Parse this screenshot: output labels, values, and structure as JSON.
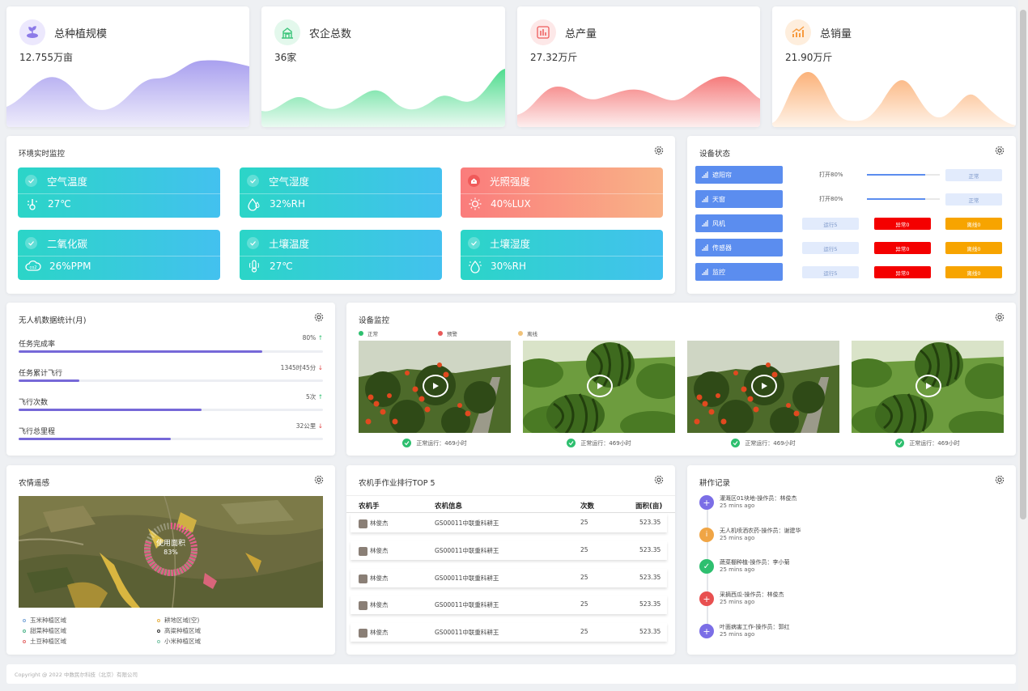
{
  "stats": [
    {
      "title": "总种植规模",
      "value": "12.755万亩",
      "icon": "plant-icon",
      "color": "#a9a0ef"
    },
    {
      "title": "农企总数",
      "value": "36家",
      "icon": "building-icon",
      "color": "#4fdc8e"
    },
    {
      "title": "总产量",
      "value": "27.32万斤",
      "icon": "bar-chart-icon",
      "color": "#f57b7b"
    },
    {
      "title": "总销量",
      "value": "21.90万斤",
      "icon": "trend-chart-icon",
      "color": "#fbb27a"
    }
  ],
  "env": {
    "title": "环境实时监控",
    "tiles": [
      {
        "name": "空气温度",
        "value": "27℃",
        "icon": "thermometer-icon"
      },
      {
        "name": "空气湿度",
        "value": "32%RH",
        "icon": "water-drop-icon"
      },
      {
        "name": "光照强度",
        "value": "40%LUX",
        "icon": "sun-icon"
      },
      {
        "name": "二氧化碳",
        "value": "26%PPM",
        "icon": "co2-cloud-icon"
      },
      {
        "name": "土壤温度",
        "value": "27℃",
        "icon": "soil-thermometer-icon"
      },
      {
        "name": "土壤湿度",
        "value": "30%RH",
        "icon": "soil-humidity-icon"
      }
    ]
  },
  "device_status": {
    "title": "设备状态",
    "rows": [
      {
        "name": "遮阳帘",
        "pct_text": "打开80%",
        "pct": 0.8,
        "status": "正常"
      },
      {
        "name": "天窗",
        "pct_text": "打开80%",
        "pct": 0.8,
        "status": "正常"
      },
      {
        "name": "风机",
        "running": "运行5",
        "abnormal": "异常0",
        "offline": "离线0"
      },
      {
        "name": "传感器",
        "running": "运行5",
        "abnormal": "异常0",
        "offline": "离线0"
      },
      {
        "name": "监控",
        "running": "运行5",
        "abnormal": "异常0",
        "offline": "离线0"
      }
    ]
  },
  "drone": {
    "title": "无人机数据统计(月)",
    "metrics": [
      {
        "label": "任务完成率",
        "value": "80%",
        "trend": "↑",
        "progress": 0.8
      },
      {
        "label": "任务累计飞行",
        "value": "1345时45分",
        "trend": "↓",
        "progress": 0.2
      },
      {
        "label": "飞行次数",
        "value": "5次",
        "trend": "↑",
        "progress": 0.6
      },
      {
        "label": "飞行总里程",
        "value": "32公里",
        "trend": "↓",
        "progress": 0.5
      }
    ]
  },
  "monitor": {
    "title": "设备监控",
    "legend": [
      {
        "label": "正常",
        "color": "#2ebf6f"
      },
      {
        "label": "预警",
        "color": "#e85a5a"
      },
      {
        "label": "离线",
        "color": "#f0c27a"
      }
    ],
    "cameras": [
      {
        "subject": "tomato",
        "status": "正常运行：469小时"
      },
      {
        "subject": "watermelon",
        "status": "正常运行：469小时"
      },
      {
        "subject": "tomato",
        "status": "正常运行：469小时"
      },
      {
        "subject": "watermelon",
        "status": "正常运行：469小时"
      }
    ]
  },
  "remote": {
    "title": "农情遥感",
    "gauge_label": "使用面积",
    "gauge_value": "83%",
    "gauge_fraction": 0.83,
    "legend": [
      {
        "label": "玉米种植区域",
        "color": "#7aa6d8"
      },
      {
        "label": "耕地区域(空)",
        "color": "#e7b34a"
      },
      {
        "label": "甜菜种植区域",
        "color": "#4fb58b"
      },
      {
        "label": "高粱种植区域",
        "color": "#333333"
      },
      {
        "label": "土豆种植区域",
        "color": "#e46a6a"
      },
      {
        "label": "小米种植区域",
        "color": "#7fc6a9"
      }
    ]
  },
  "ranking": {
    "title": "农机手作业排行TOP 5",
    "columns": [
      "农机手",
      "农机信息",
      "次数",
      "面积(亩)"
    ],
    "rows": [
      [
        "林俊杰",
        "GS00011中联重科耕王",
        "25",
        "523.35"
      ],
      [
        "林俊杰",
        "GS00011中联重科耕王",
        "25",
        "523.35"
      ],
      [
        "林俊杰",
        "GS00011中联重科耕王",
        "25",
        "523.35"
      ],
      [
        "林俊杰",
        "GS00011中联重科耕王",
        "25",
        "523.35"
      ],
      [
        "林俊杰",
        "GS00011中联重科耕王",
        "25",
        "523.35"
      ]
    ]
  },
  "records": {
    "title": "耕作记录",
    "items": [
      {
        "text": "灌溉区01块地-操作员：林俊杰",
        "time": "25 mins ago",
        "color": "#7b6ee6",
        "icon": "plus-icon",
        "glyph": "+"
      },
      {
        "text": "无人机喷洒农药-操作员：谢建华",
        "time": "25 mins ago",
        "color": "#f0a545",
        "icon": "info-icon",
        "glyph": "i"
      },
      {
        "text": "蔬菜棚种植-操作员：李小菊",
        "time": "25 mins ago",
        "color": "#2ebf6f",
        "icon": "check-icon",
        "glyph": "✓"
      },
      {
        "text": "采摘西瓜-操作员：林俊杰",
        "time": "25 mins ago",
        "color": "#e85050",
        "icon": "plus-icon",
        "glyph": "+"
      },
      {
        "text": "叶面病害工作-操作员：郭红",
        "time": "25 mins ago",
        "color": "#7b6ee6",
        "icon": "plus-icon",
        "glyph": "+"
      }
    ]
  },
  "footer": {
    "text": "Copyright @ 2022 中数民尔科技（北京）有限公司"
  }
}
